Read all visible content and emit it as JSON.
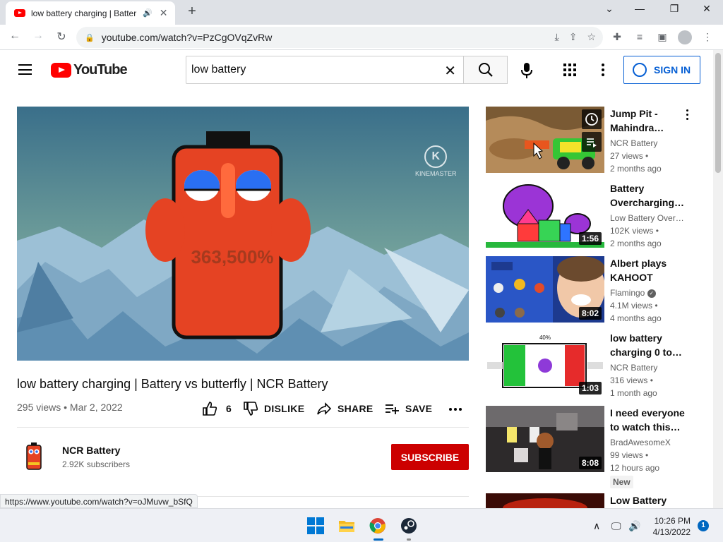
{
  "browser": {
    "tab_title": "low battery charging | Batter",
    "new_tab": "+",
    "url": "youtube.com/watch?v=PzCgOVqZvRw",
    "status_url": "https://www.youtube.com/watch?v=oJMuvw_bSfQ"
  },
  "yt": {
    "logo_text": "YouTube",
    "search_value": "low battery",
    "sign_in": "SIGN IN"
  },
  "player": {
    "overlay_value": "363,500%",
    "watermark": "KINEMASTER"
  },
  "video": {
    "title": "low battery charging | Battery vs butterfly | NCR Battery",
    "meta": "295 views • Mar 2, 2022",
    "like_count": "6",
    "dislike": "DISLIKE",
    "share": "SHARE",
    "save": "SAVE"
  },
  "channel": {
    "name": "NCR Battery",
    "subs": "2.92K subscribers",
    "subscribe": "SUBSCRIBE"
  },
  "recs": [
    {
      "title": "Jump Pit - Mahindra…",
      "channel": "NCR Battery",
      "views": "27 views •",
      "age": "2 months ago",
      "duration": ""
    },
    {
      "title": "Battery Overcharging…",
      "channel": "Low Battery Over…",
      "views": "102K views •",
      "age": "2 months ago",
      "duration": "1:56"
    },
    {
      "title": "Albert plays KAHOOT",
      "channel": "Flamingo",
      "views": "4.1M views •",
      "age": "4 months ago",
      "duration": "8:02"
    },
    {
      "title": "low battery charging 0 to…",
      "channel": "NCR Battery",
      "views": "316 views •",
      "age": "1 month ago",
      "duration": "1:03",
      "thumb_label": "40%"
    },
    {
      "title": "I need everyone to watch this…",
      "channel": "BradAwesomeX",
      "views": "99 views •",
      "age": "12 hours ago",
      "duration": "8:08",
      "badge": "New"
    },
    {
      "title": "Low Battery"
    }
  ],
  "taskbar": {
    "time": "10:26 PM",
    "date": "4/13/2022",
    "notifications": "1"
  }
}
